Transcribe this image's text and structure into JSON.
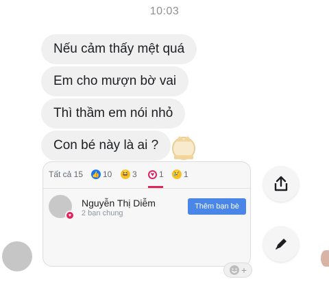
{
  "status": {
    "time": "10:03"
  },
  "messages": [
    {
      "text": "Nếu cảm thấy mệt quá"
    },
    {
      "text": "Em cho mượn bờ vai"
    },
    {
      "text": "Thì thầm em nói nhỏ"
    },
    {
      "text": "Con bé này là ai ?"
    }
  ],
  "reactions": {
    "tabs": [
      {
        "label": "Tất cả 15",
        "icon": "none"
      },
      {
        "label": "10",
        "icon": "like-icon"
      },
      {
        "label": "3",
        "icon": "haha-icon"
      },
      {
        "label": "1",
        "icon": "love-icon"
      },
      {
        "label": "1",
        "icon": "sad-icon"
      }
    ],
    "user": {
      "name": "Nguyễn Thị Diễm",
      "mutual": "2 bạn chung",
      "add_friend_label": "Thêm bạn bè"
    }
  },
  "colors": {
    "bubble": "#f0f0f0",
    "add_friend": "#4a86e8",
    "love": "#e0245e",
    "like": "#1877f2"
  }
}
